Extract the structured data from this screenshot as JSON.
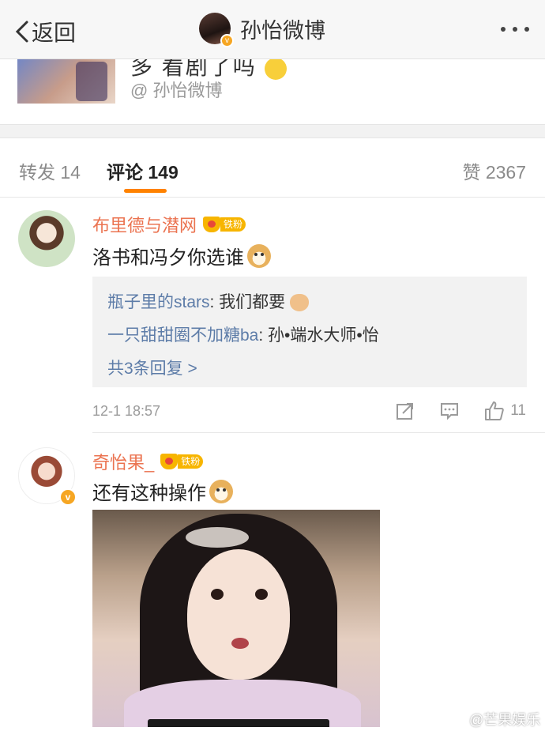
{
  "header": {
    "back_label": "返回",
    "title": "孙怡微博"
  },
  "original_post": {
    "text": "多 看剧了吗",
    "author": "@ 孙怡微博"
  },
  "tabs": [
    {
      "label": "转发",
      "count": "14"
    },
    {
      "label": "评论",
      "count": "149"
    },
    {
      "label": "赞",
      "count": "2367"
    }
  ],
  "comments": [
    {
      "username": "布里德与潜网",
      "badge": "铁粉",
      "text": "洛书和冯夕你选谁",
      "replies": [
        {
          "name": "瓶子里的stars",
          "text": ": 我们都要"
        },
        {
          "name": "一只甜甜圈不加糖ba",
          "text": ": 孙•端水大师•怡"
        }
      ],
      "more_replies": "共3条回复 >",
      "time": "12-1 18:57",
      "likes": "11"
    },
    {
      "username": "奇怡果_",
      "badge": "铁粉",
      "text": "还有这种操作"
    }
  ],
  "watermark": "@芒果娱乐"
}
